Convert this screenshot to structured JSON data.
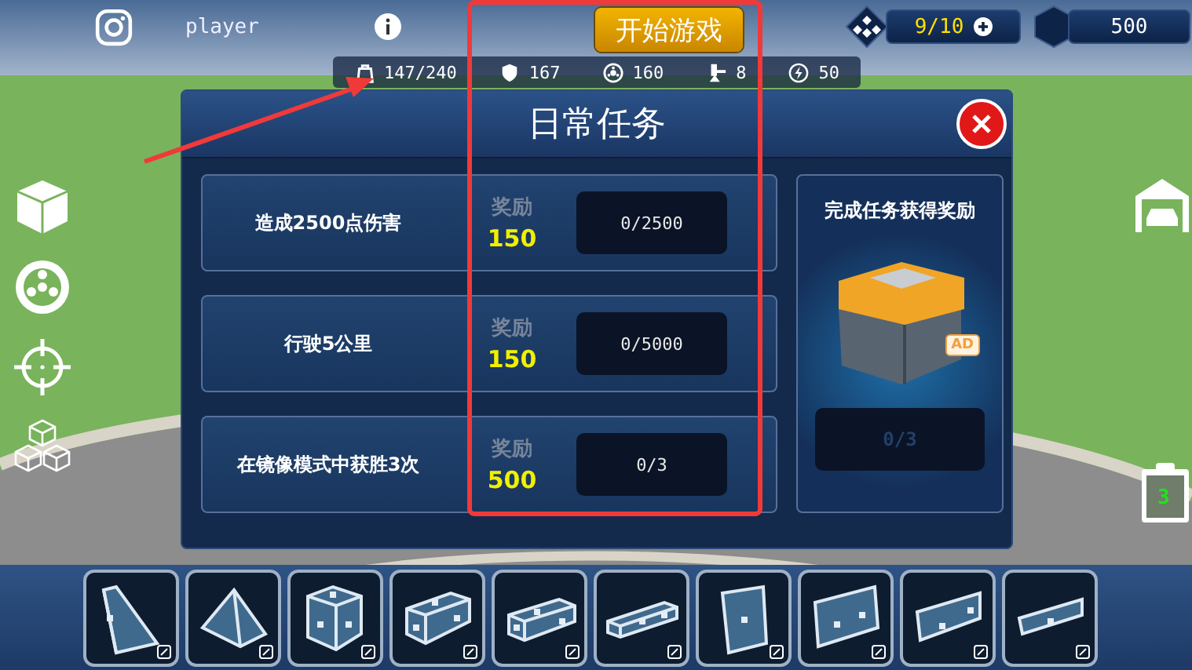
{
  "top_bar": {
    "player_name": "player",
    "start_button": "开始游戏",
    "energy": "9/10",
    "coins": "500"
  },
  "stats": [
    {
      "kind": "weight",
      "value": "147/240"
    },
    {
      "kind": "armor",
      "value": "167"
    },
    {
      "kind": "wheel",
      "value": "160"
    },
    {
      "kind": "weapon",
      "value": "8"
    },
    {
      "kind": "power",
      "value": "50"
    }
  ],
  "dialog": {
    "title": "日常任务",
    "missions": [
      {
        "task": "造成2500点伤害",
        "reward_label": "奖励",
        "reward": "150",
        "progress": "0/2500",
        "level": 0
      },
      {
        "task": "行驶5公里",
        "reward_label": "奖励",
        "reward": "150",
        "progress": "0/5000",
        "level": 0
      },
      {
        "task": "在镜像模式中获胜3次",
        "reward_label": "奖励",
        "reward": "500",
        "progress": "0/3",
        "level": 0
      }
    ],
    "reward_card": {
      "title": "完成任务获得奖励",
      "ad_badge": "AD",
      "progress": "0/3",
      "level": 0
    }
  },
  "garage_badge": "3",
  "blocks": [
    {
      "kind": "wedge"
    },
    {
      "kind": "pyramid"
    },
    {
      "kind": "cube"
    },
    {
      "kind": "block2"
    },
    {
      "kind": "block3"
    },
    {
      "kind": "block4"
    },
    {
      "kind": "panel1"
    },
    {
      "kind": "panel2"
    },
    {
      "kind": "panel3"
    },
    {
      "kind": "panel4"
    }
  ]
}
